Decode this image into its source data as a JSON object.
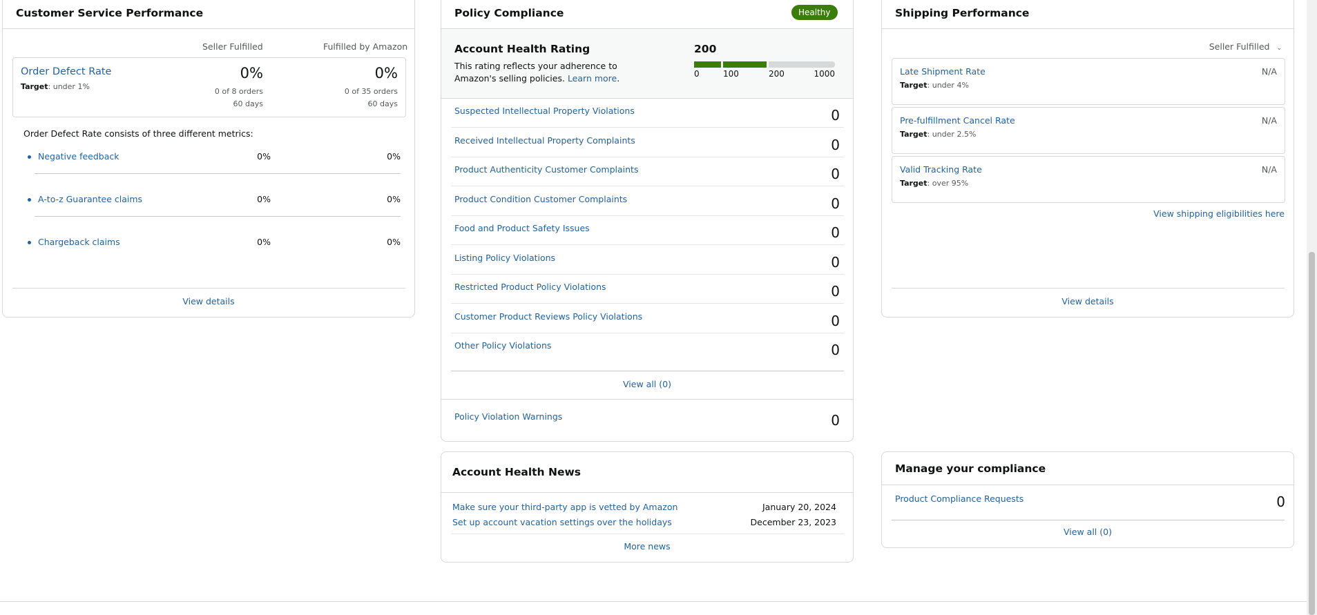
{
  "customer_service": {
    "title": "Customer Service Performance",
    "col_seller": "Seller Fulfilled",
    "col_amazon": "Fulfilled by Amazon",
    "odr_title": "Order Defect Rate",
    "odr_target_label": "Target",
    "odr_target_value": ": under 1%",
    "seller_pct": "0%",
    "seller_orders": "0 of 8 orders",
    "seller_days": "60 days",
    "amazon_pct": "0%",
    "amazon_orders": "0 of 35 orders",
    "amazon_days": "60 days",
    "intro": "Order Defect Rate consists of three different metrics:",
    "metrics": [
      {
        "label": "Negative feedback",
        "seller": "0%",
        "amazon": "0%"
      },
      {
        "label": "A-to-z Guarantee claims",
        "seller": "0%",
        "amazon": "0%"
      },
      {
        "label": "Chargeback claims",
        "seller": "0%",
        "amazon": "0%"
      }
    ],
    "view_details": "View details"
  },
  "policy": {
    "title": "Policy Compliance",
    "badge": "Healthy",
    "ahr_title": "Account Health Rating",
    "ahr_desc": "This rating reflects your adherence to Amazon's selling policies.",
    "learn_more": "Learn more",
    "score": "200",
    "score_value": 200,
    "ticks": [
      "0",
      "100",
      "200",
      "1000"
    ],
    "colors": {
      "bar_fill": "#3a7d0a",
      "bar_empty": "#d5d9d9"
    },
    "rows": [
      {
        "label": "Suspected Intellectual Property Violations",
        "value": "0"
      },
      {
        "label": "Received Intellectual Property Complaints",
        "value": "0"
      },
      {
        "label": "Product Authenticity Customer Complaints",
        "value": "0"
      },
      {
        "label": "Product Condition Customer Complaints",
        "value": "0"
      },
      {
        "label": "Food and Product Safety Issues",
        "value": "0"
      },
      {
        "label": "Listing Policy Violations",
        "value": "0"
      },
      {
        "label": "Restricted Product Policy Violations",
        "value": "0"
      },
      {
        "label": "Customer Product Reviews Policy Violations",
        "value": "0"
      },
      {
        "label": "Other Policy Violations",
        "value": "0"
      }
    ],
    "view_all": "View all (0)",
    "warnings_label": "Policy Violation Warnings",
    "warnings_value": "0"
  },
  "shipping": {
    "title": "Shipping Performance",
    "dropdown": "Seller Fulfilled",
    "metrics": [
      {
        "label": "Late Shipment Rate",
        "target_label": "Target",
        "target_value": ": under 4%",
        "value": "N/A"
      },
      {
        "label": "Pre-fulfillment Cancel Rate",
        "target_label": "Target",
        "target_value": ": under 2.5%",
        "value": "N/A"
      },
      {
        "label": "Valid Tracking Rate",
        "target_label": "Target",
        "target_value": ": over 95%",
        "value": "N/A"
      }
    ],
    "eligibilities_link": "View shipping eligibilities here",
    "view_details": "View details"
  },
  "news": {
    "title": "Account Health News",
    "items": [
      {
        "title": "Make sure your third-party app is vetted by Amazon",
        "date": "January 20, 2024"
      },
      {
        "title": "Set up account vacation settings over the holidays",
        "date": "December 23, 2023"
      }
    ],
    "more": "More news"
  },
  "compliance": {
    "title": "Manage your compliance",
    "row_label": "Product Compliance Requests",
    "row_value": "0",
    "view_all": "View all (0)"
  }
}
